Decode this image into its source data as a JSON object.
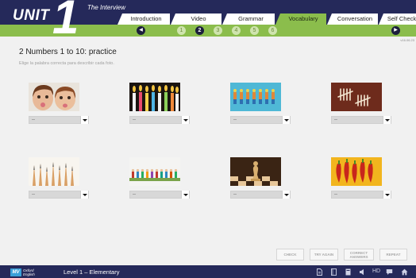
{
  "header": {
    "unit_word": "UNIT",
    "unit_number": "1",
    "section_title": "The Interview",
    "tabs": [
      {
        "label": "Introduction",
        "active": false
      },
      {
        "label": "Video",
        "active": false
      },
      {
        "label": "Grammar",
        "active": false
      },
      {
        "label": "Vocabulary",
        "active": true
      },
      {
        "label": "Conversation",
        "active": false
      },
      {
        "label": "Self Check",
        "active": false
      }
    ]
  },
  "nav": {
    "prev_icon": "chevron-left-icon",
    "next_icon": "chevron-right-icon",
    "steps": [
      "1",
      "2",
      "3",
      "4",
      "5",
      "6"
    ],
    "current_step": "2",
    "version": "v16.06.23"
  },
  "exercise": {
    "title": "2  Numbers 1 to 10: practice",
    "instructions": "Elige la palabra correcta para describir cada foto.",
    "items": [
      {
        "photo": "two children",
        "selected": "--"
      },
      {
        "photo": "birthday candles",
        "selected": "--"
      },
      {
        "photo": "toy figures on blue",
        "selected": "--"
      },
      {
        "photo": "tally marks",
        "selected": "--"
      },
      {
        "photo": "sharpened pencils",
        "selected": "--"
      },
      {
        "photo": "row of small figures",
        "selected": "--"
      },
      {
        "photo": "chess piece",
        "selected": "--"
      },
      {
        "photo": "red chili peppers",
        "selected": "--"
      }
    ]
  },
  "buttons": {
    "check": "CHECK",
    "try_again": "TRY AGAIN",
    "correct_answers": "CORRECT ANSWERS",
    "repeat": "REPEAT"
  },
  "footer": {
    "logo_mark": "MV",
    "logo_text_1": "Oxford",
    "logo_text_2": "English",
    "level": "Level 1 – Elementary",
    "hd_label": "HD"
  },
  "colors": {
    "navy": "#25295a",
    "green": "#8bbd4c",
    "background": "#f1f1f1"
  }
}
